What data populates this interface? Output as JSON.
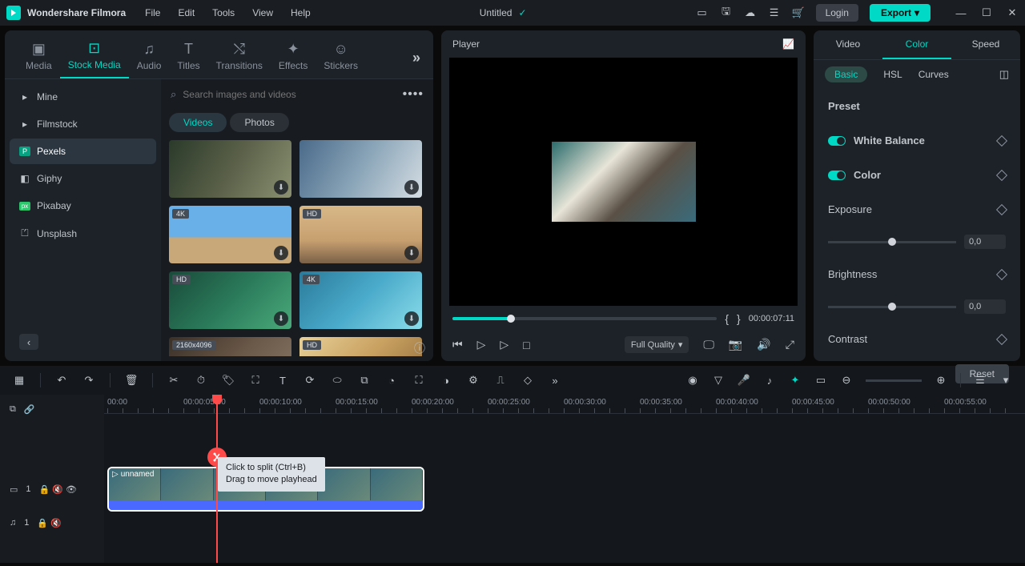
{
  "app_name": "Wondershare Filmora",
  "menu": [
    "File",
    "Edit",
    "Tools",
    "View",
    "Help"
  ],
  "project_title": "Untitled",
  "login_label": "Login",
  "export_label": "Export",
  "top_tabs": [
    {
      "label": "Media"
    },
    {
      "label": "Stock Media",
      "active": true
    },
    {
      "label": "Audio"
    },
    {
      "label": "Titles"
    },
    {
      "label": "Transitions"
    },
    {
      "label": "Effects"
    },
    {
      "label": "Stickers"
    }
  ],
  "sources": [
    {
      "label": "Mine",
      "icon": "▸"
    },
    {
      "label": "Filmstock",
      "icon": "▸"
    },
    {
      "label": "Pexels",
      "icon": "P",
      "active": true,
      "badge_color": "#07a081"
    },
    {
      "label": "Giphy",
      "icon": "G"
    },
    {
      "label": "Pixabay",
      "icon": "px",
      "badge_color": "#2ec66d"
    },
    {
      "label": "Unsplash",
      "icon": "U"
    }
  ],
  "search_placeholder": "Search images and videos",
  "subtabs": [
    {
      "label": "Videos",
      "active": true
    },
    {
      "label": "Photos"
    }
  ],
  "thumbs": [
    {
      "bg": "linear-gradient(120deg,#2a3a2a,#5a6048,#8a9070)",
      "badge": ""
    },
    {
      "bg": "linear-gradient(120deg,#4a6a8a,#8aa5b8,#d5dde3)",
      "badge": ""
    },
    {
      "bg": "linear-gradient(180deg,#6ab0e8 0%,#6ab0e8 55%,#c8a878 55%)",
      "badge": "4K"
    },
    {
      "bg": "linear-gradient(180deg,#d8b888 0%,#c8a070 60%,#7a6048 100%)",
      "badge": "HD"
    },
    {
      "bg": "linear-gradient(135deg,#1a4a3a,#2a7a5a,#4aaa7a)",
      "badge": "HD"
    },
    {
      "bg": "linear-gradient(135deg,#2a7a9a,#4aaaca,#8addea)",
      "badge": "4K"
    },
    {
      "bg": "linear-gradient(135deg,#3a3028,#6a5848,#8a7a68)",
      "badge": "2160x4096"
    },
    {
      "bg": "linear-gradient(135deg,#e8d098,#c8a060,#8a6838)",
      "badge": "HD"
    }
  ],
  "player_label": "Player",
  "scrub_marks": {
    "in": "{",
    "out": "}"
  },
  "timecode": "00:00:07:11",
  "quality_label": "Full Quality",
  "right_tabs": [
    {
      "label": "Video"
    },
    {
      "label": "Color",
      "active": true
    },
    {
      "label": "Speed"
    }
  ],
  "color_subtabs": [
    {
      "label": "Basic",
      "active": true
    },
    {
      "label": "HSL"
    },
    {
      "label": "Curves"
    }
  ],
  "preset_label": "Preset",
  "color_toggles": [
    {
      "label": "White Balance"
    },
    {
      "label": "Color"
    }
  ],
  "color_sliders": [
    {
      "label": "Exposure",
      "value": "0,0"
    },
    {
      "label": "Brightness",
      "value": "0,0"
    },
    {
      "label": "Contrast",
      "value": ""
    }
  ],
  "reset_label": "Reset",
  "ruler_marks": [
    "00:00",
    "00:00:05:00",
    "00:00:10:00",
    "00:00:15:00",
    "00:00:20:00",
    "00:00:25:00",
    "00:00:30:00",
    "00:00:35:00",
    "00:00:40:00",
    "00:00:45:00",
    "00:00:50:00",
    "00:00:55:00"
  ],
  "clip_name": "unnamed",
  "tooltip_line1": "Click to split (Ctrl+B)",
  "tooltip_line2": "Drag to move playhead",
  "track_video_num": "1",
  "track_audio_num": "1"
}
